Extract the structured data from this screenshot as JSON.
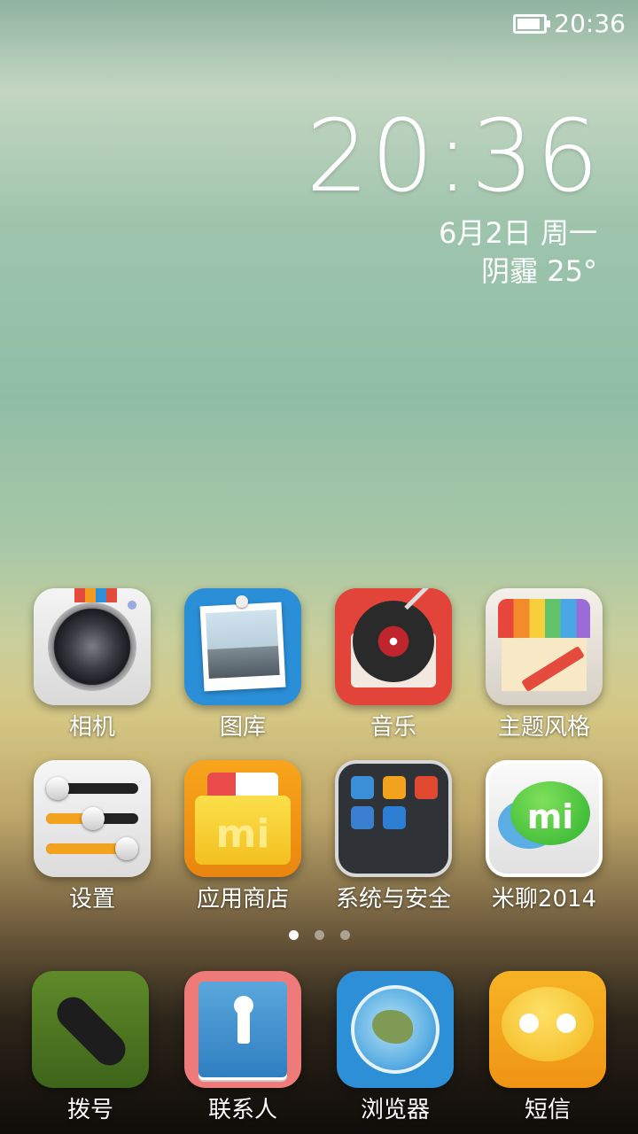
{
  "status_bar": {
    "time": "20:36",
    "battery_level": 0.85
  },
  "lockclock": {
    "time": "20:36",
    "date": "6月2日 周一",
    "weather": "阴霾 25°"
  },
  "apps_row1": [
    {
      "label": "相机",
      "icon": "camera-icon"
    },
    {
      "label": "图库",
      "icon": "gallery-icon"
    },
    {
      "label": "音乐",
      "icon": "music-icon"
    },
    {
      "label": "主题风格",
      "icon": "theme-icon"
    }
  ],
  "apps_row2": [
    {
      "label": "设置",
      "icon": "settings-icon"
    },
    {
      "label": "应用商店",
      "icon": "app-store-icon"
    },
    {
      "label": "系统与安全",
      "icon": "folder-icon"
    },
    {
      "label": "米聊2014",
      "icon": "miliao-icon"
    }
  ],
  "folder_icons": [
    "cloud-icon",
    "mi-icon",
    "mi-red-icon",
    "search-icon",
    "play-icon"
  ],
  "pager": {
    "pages": 3,
    "current": 1
  },
  "dock": [
    {
      "label": "拨号",
      "icon": "phone-icon"
    },
    {
      "label": "联系人",
      "icon": "contacts-icon"
    },
    {
      "label": "浏览器",
      "icon": "browser-icon"
    },
    {
      "label": "短信",
      "icon": "messages-icon"
    }
  ],
  "store_badge": "mi",
  "chat_badge": "mi"
}
